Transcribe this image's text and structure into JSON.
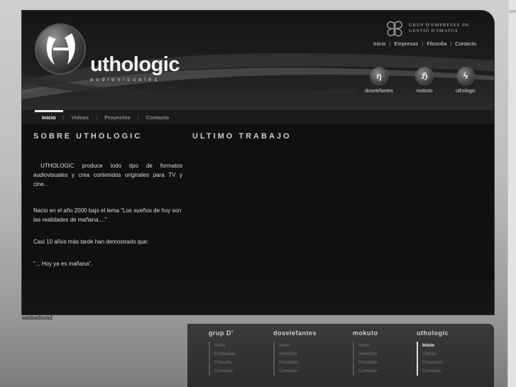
{
  "header": {
    "brand_name": "uthologic",
    "brand_sub": "audiovisuales",
    "group_line1": "GRUP D'EMPRESES DE",
    "group_line2": "GESTIÓ D'IMATGE",
    "topnav": [
      "Inicio",
      "Empresas",
      "Filosofia",
      "Contacto"
    ],
    "sites": [
      {
        "label": "doselefantes",
        "glyph": "ŋ"
      },
      {
        "label": "mokuto",
        "glyph": "ℌ"
      },
      {
        "label": "uthologic",
        "glyph": "ϟ"
      }
    ]
  },
  "tabs": [
    "Inicio",
    "Videos",
    "Proyectos",
    "Contacto"
  ],
  "main": {
    "left_title": "SOBRE UTHOLOGIC",
    "right_title": "ULTIMO TRABAJO",
    "paragraphs": [
      "UTHOLOGIC produce todo tipo de formatos audiovisuales y crea contenidos originales para TV y cine...",
      "Nacio en el año 2000 bajo el lema \"Los sueños de hoy son las realidades de mañana....\"",
      "Casi 10 años más tarde han demostrado que:",
      "\"... Hoy ya es mañana\"."
    ]
  },
  "below_text": "sadsadssad",
  "footer": {
    "columns": [
      {
        "title": "grup D'",
        "items": [
          "Inicio",
          "Empresas",
          "Filosofia",
          "Contacto"
        ]
      },
      {
        "title": "doselefantes",
        "items": [
          "Inicio",
          "Servicios",
          "Portafolio",
          "Contacto"
        ]
      },
      {
        "title": "mokuto",
        "items": [
          "Inicio",
          "Servicios",
          "Portafolio",
          "Contacto"
        ]
      },
      {
        "title": "uthologic",
        "items": [
          "Inicio",
          "Videos",
          "Proyectos",
          "Contacto"
        ]
      }
    ]
  },
  "colors": {
    "accent": "#ffffff",
    "panel": "#111111",
    "footer": "#333333"
  }
}
